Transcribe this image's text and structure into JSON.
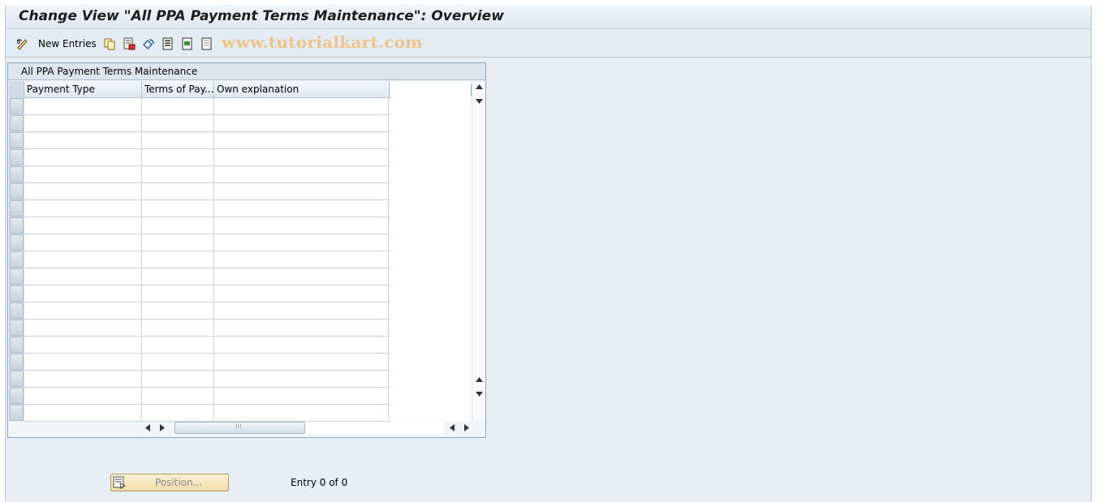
{
  "title": "Change View \"All PPA Payment Terms Maintenance\": Overview",
  "toolbar": {
    "items": [
      {
        "icon": "pencil-glasses-icon",
        "label": ""
      },
      {
        "icon": "new-entries",
        "label": "New Entries"
      },
      {
        "icon": "copy-icon",
        "label": ""
      },
      {
        "icon": "delete-icon",
        "label": ""
      },
      {
        "icon": "undo-icon",
        "label": ""
      },
      {
        "icon": "select-all-icon",
        "label": ""
      },
      {
        "icon": "select-block-icon",
        "label": ""
      },
      {
        "icon": "deselect-all-icon",
        "label": ""
      }
    ],
    "watermark": "www.tutorialkart.com"
  },
  "table": {
    "title": "All PPA Payment Terms Maintenance",
    "columns": [
      "Payment Type",
      "Terms of Pay...",
      "Own explanation"
    ],
    "rows": []
  },
  "footer": {
    "position_label": "Position...",
    "entry_text": "Entry 0 of 0"
  },
  "colors": {
    "background": "#e9eef4",
    "watermark": "#ecc48c",
    "position_button": "#f0dca7"
  }
}
